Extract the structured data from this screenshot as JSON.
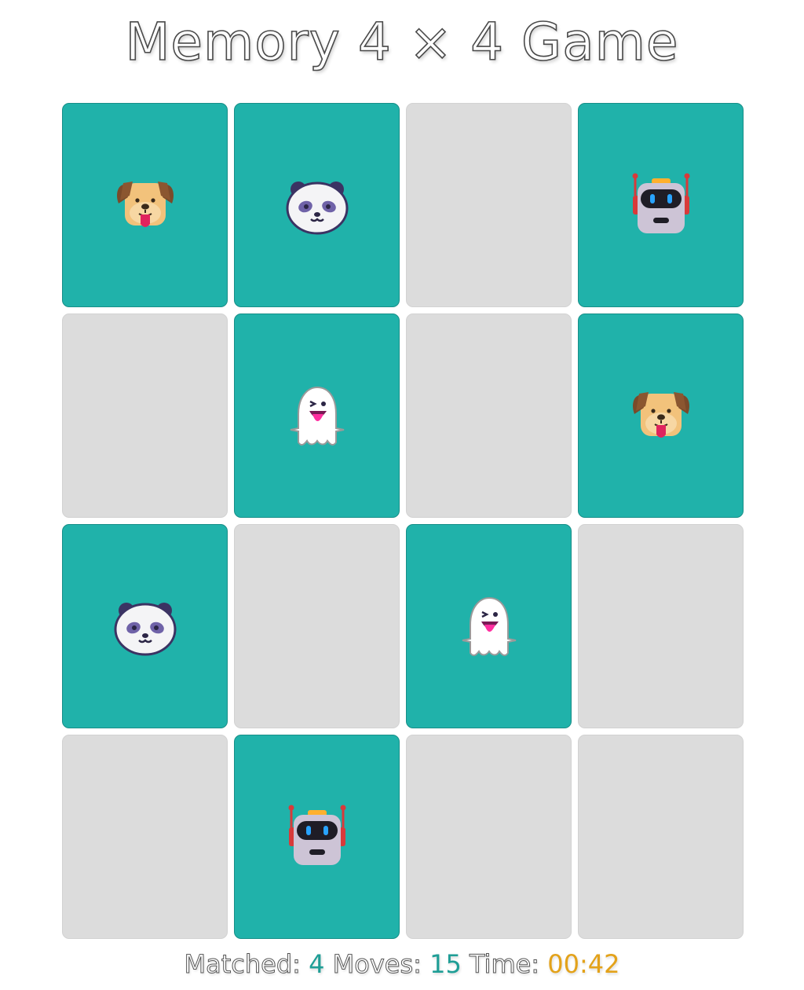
{
  "game": {
    "title": "Memory 4 × 4 Game"
  },
  "colors": {
    "card_faceup": "#20b2aa",
    "card_facedown": "#dcdcdc",
    "matched_value": "#1f9e96",
    "moves_value": "#1f9e96",
    "time_value": "#e3a21a"
  },
  "board": {
    "rows": [
      [
        {
          "state": "faceup",
          "icon": "dog-face-icon"
        },
        {
          "state": "faceup",
          "icon": "panda-face-icon"
        },
        {
          "state": "facedown",
          "icon": ""
        },
        {
          "state": "faceup",
          "icon": "robot-face-icon"
        }
      ],
      [
        {
          "state": "facedown",
          "icon": ""
        },
        {
          "state": "faceup",
          "icon": "ghost-icon"
        },
        {
          "state": "facedown",
          "icon": ""
        },
        {
          "state": "faceup",
          "icon": "dog-face-icon"
        }
      ],
      [
        {
          "state": "faceup",
          "icon": "panda-face-icon"
        },
        {
          "state": "facedown",
          "icon": ""
        },
        {
          "state": "faceup",
          "icon": "ghost-icon"
        },
        {
          "state": "facedown",
          "icon": ""
        }
      ],
      [
        {
          "state": "facedown",
          "icon": ""
        },
        {
          "state": "faceup",
          "icon": "robot-face-icon"
        },
        {
          "state": "facedown",
          "icon": ""
        },
        {
          "state": "facedown",
          "icon": ""
        }
      ]
    ]
  },
  "status": {
    "matched_label": "Matched:",
    "matched_value": "4",
    "moves_label": "Moves:",
    "moves_value": "15",
    "time_label": "Time:",
    "time_value": "00:42"
  }
}
